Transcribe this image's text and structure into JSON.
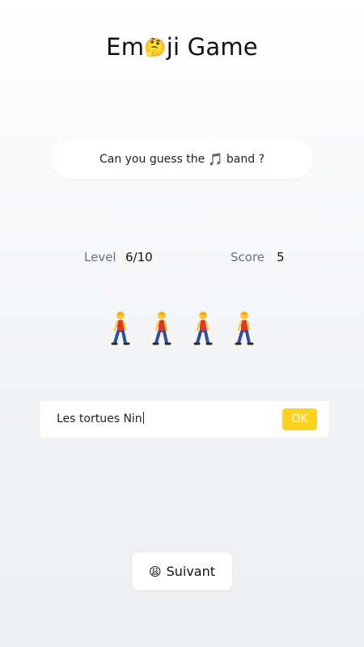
{
  "app": {
    "title_before": "Em",
    "title_emoji": "🤔",
    "title_after": "ji Game"
  },
  "question": {
    "text_before": "Can you guess the",
    "icon": "🎵",
    "text_after": "band ?"
  },
  "stats": {
    "level_label": "Level",
    "level_value": "6/10",
    "score_label": "Score",
    "score_value": "5"
  },
  "puzzle": {
    "emojis": [
      "person-walking-icon",
      "person-walking-icon",
      "person-walking-icon",
      "person-walking-icon"
    ]
  },
  "answer": {
    "value": "Les tortues Nin",
    "submit_label": "OK"
  },
  "next": {
    "icon": "😩",
    "label": "Suivant"
  },
  "colors": {
    "accent": "#ffd21f",
    "muted_text": "#6b7280"
  }
}
